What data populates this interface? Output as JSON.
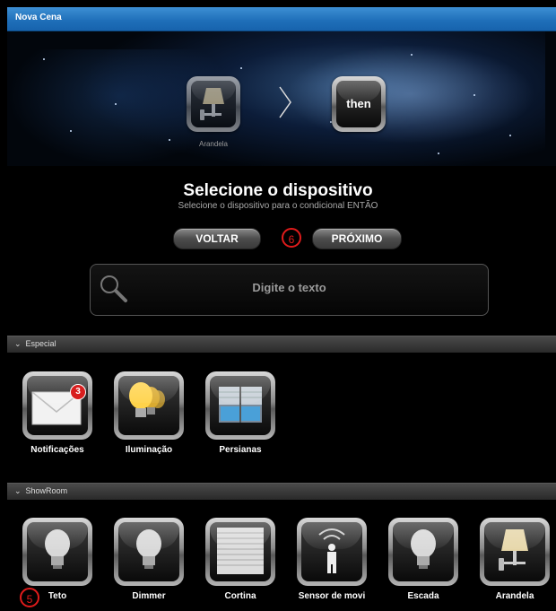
{
  "window": {
    "title": "Nova Cena"
  },
  "steps": {
    "if_device_label": "Arandela",
    "then_label": "then"
  },
  "header": {
    "title": "Selecione o dispositivo",
    "subtitle": "Selecione o dispositivo para o condicional ENTÃO"
  },
  "nav": {
    "back_label": "VOLTAR",
    "next_label": "PRÓXIMO",
    "marker_next": "6"
  },
  "search": {
    "placeholder": "Digite o texto"
  },
  "sections": [
    {
      "title": "Especial",
      "items": [
        {
          "label": "Notificações",
          "icon": "envelope-icon",
          "badge": "3"
        },
        {
          "label": "Iluminação",
          "icon": "bulbs-icon"
        },
        {
          "label": "Persianas",
          "icon": "blinds-icon"
        }
      ]
    },
    {
      "title": "ShowRoom",
      "items": [
        {
          "label": "Teto",
          "icon": "bulb-icon"
        },
        {
          "label": "Dimmer",
          "icon": "bulb-icon"
        },
        {
          "label": "Cortina",
          "icon": "curtain-icon"
        },
        {
          "label": "Sensor de movi",
          "icon": "motion-sensor-icon"
        },
        {
          "label": "Escada",
          "icon": "bulb-icon"
        },
        {
          "label": "Arandela",
          "icon": "wall-lamp-icon"
        }
      ]
    }
  ],
  "markers": {
    "teto": "5"
  }
}
